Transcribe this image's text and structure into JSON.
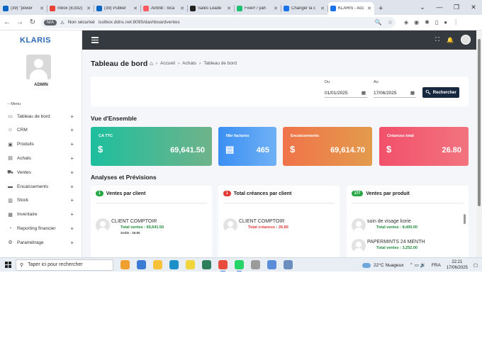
{
  "browser": {
    "tabs": [
      {
        "title": "(39) \"power",
        "color": "#0a66c2"
      },
      {
        "title": "Inbox (8,932)",
        "color": "#ea4335"
      },
      {
        "title": "(39) Publier",
        "color": "#0a66c2"
      },
      {
        "title": "Airbnb : loca",
        "color": "#ff5a5f"
      },
      {
        "title": "Sales Leade",
        "color": "#222222"
      },
      {
        "title": "Fiverr / yah",
        "color": "#1dbf73"
      },
      {
        "title": "Changer la c",
        "color": "#1a73e8"
      },
      {
        "title": "KLARIS - Acc",
        "color": "#1a73e8",
        "active": true
      }
    ],
    "new_tab": "+",
    "window_controls": [
      "⌄",
      "—",
      "❐",
      "✕"
    ],
    "nav": {
      "back": "←",
      "forward": "→",
      "reload": "↻"
    },
    "address": {
      "chip": "N/A",
      "security": "Non sécurisé",
      "url": "isolbox.ddns.net:8095/dashboardventes"
    }
  },
  "sidebar": {
    "brand": "KLARIS",
    "user": "ADMIN",
    "menu_title": "-- Menu",
    "items": [
      {
        "label": "Tableau de bord",
        "icon": "▭"
      },
      {
        "label": "CRM",
        "icon": "☺"
      },
      {
        "label": "Produits",
        "icon": "▣"
      },
      {
        "label": "Achats",
        "icon": "▤"
      },
      {
        "label": "Ventes",
        "icon": "⛟"
      },
      {
        "label": "Encaissements",
        "icon": "▬"
      },
      {
        "label": "Stock",
        "icon": "▥"
      },
      {
        "label": "Inventaire",
        "icon": "▦"
      },
      {
        "label": "Reporting financier",
        "icon": "◔"
      },
      {
        "label": "Paramétrage",
        "icon": "⚙"
      }
    ],
    "expand_symbol": "+"
  },
  "topbar": {
    "fullscreen_icon": "⛶",
    "bell_icon": "🔔"
  },
  "page": {
    "title": "Tableau de bord",
    "breadcrumb": [
      "Accueil",
      "Achats",
      "Tableau de bord"
    ],
    "separator": "›",
    "filters": {
      "from_label": "Du",
      "from_value": "01/01/2025",
      "to_label": "Au",
      "to_value": "17/06/2025",
      "search_label": "Rechercher"
    },
    "overview_title": "Vue d'Ensemble",
    "kpis": [
      {
        "label": "CA TTC",
        "icon": "$",
        "value": "69,641.50",
        "color_from": "#1dbf9e",
        "color_to": "#6fb38a"
      },
      {
        "label": "Nbr factures",
        "icon": "▤",
        "value": "465",
        "color_from": "#3b8ff3",
        "color_to": "#6fb1f5"
      },
      {
        "label": "Encaissements",
        "icon": "$",
        "value": "69,614.70",
        "color_from": "#f0734a",
        "color_to": "#e39b4c"
      },
      {
        "label": "Créances total",
        "icon": "$",
        "value": "26.80",
        "color_from": "#f2506b",
        "color_to": "#f2747f"
      }
    ],
    "analysis_title": "Analyses et Prévisions",
    "panels": [
      {
        "badge": "1",
        "badge_color": "#28a745",
        "title": "Ventes par client",
        "entries": [
          {
            "name": "CLIENT COMPTOIR",
            "sub": "Total ventes : 69,641.50",
            "sub_color": "#1e8a3c",
            "sub2": "Solde : 26.80"
          }
        ]
      },
      {
        "badge": "1",
        "badge_color": "#e53935",
        "title": "Total créances par client",
        "entries": [
          {
            "name": "CLIENT COMPTOIR",
            "sub": "Total créances : 26.80",
            "sub_color": "#e53935"
          }
        ]
      },
      {
        "badge": "277",
        "badge_color": "#28a745",
        "title": "Ventes par produit",
        "entries": [
          {
            "name": "soin de visage korie",
            "sub": "Total ventes : 8,400.00",
            "sub_color": "#1e8a3c"
          },
          {
            "name": "PAPERMINTS 24 MENTH",
            "sub": "Total ventes : 3,252.00",
            "sub_color": "#1e8a3c"
          }
        ]
      }
    ]
  },
  "taskbar": {
    "search_placeholder": "Taper ici pour rechercher",
    "apps": [
      "#f0a030",
      "#3b7bd4",
      "#f7c13a",
      "#1e90c8",
      "#f2d43b",
      "#2e7d5b",
      "#e74c3c",
      "#25d366",
      "#9b9b9b",
      "#5b8dd9",
      "#6c8ebf"
    ],
    "weather": "22°C  Nuageux",
    "tray_icons": "⌃  ▭  🔊",
    "lang": "FRA",
    "time": "22:21",
    "date": "17/06/2025"
  }
}
